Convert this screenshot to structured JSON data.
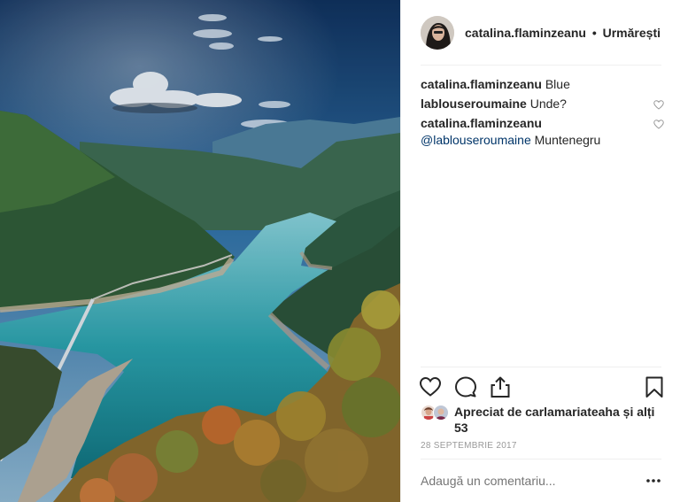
{
  "post": {
    "image_alt": "Blue lake in Montenegro mountains"
  },
  "header": {
    "username": "catalina.flaminzeanu",
    "separator": "•",
    "follow_label": "Urmărești"
  },
  "comments": [
    {
      "user": "catalina.flaminzeanu",
      "text": "Blue",
      "mention": ""
    },
    {
      "user": "lablouseroumaine",
      "text": "Unde?",
      "mention": ""
    },
    {
      "user": "catalina.flaminzeanu",
      "mention": "@lablouseroumaine",
      "text": "Muntenegru"
    }
  ],
  "actions": {
    "like_icon": "heart-icon",
    "comment_icon": "comment-icon",
    "share_icon": "share-icon",
    "save_icon": "bookmark-icon"
  },
  "likes": {
    "text": "Apreciat de carlamariateaha și alți 53"
  },
  "date": "28 SEPTEMBRIE 2017",
  "add_comment": {
    "placeholder": "Adaugă un comentariu..."
  },
  "colors": {
    "text": "#262626",
    "muted": "#999999",
    "mention": "#003569",
    "divider": "#efefef"
  }
}
